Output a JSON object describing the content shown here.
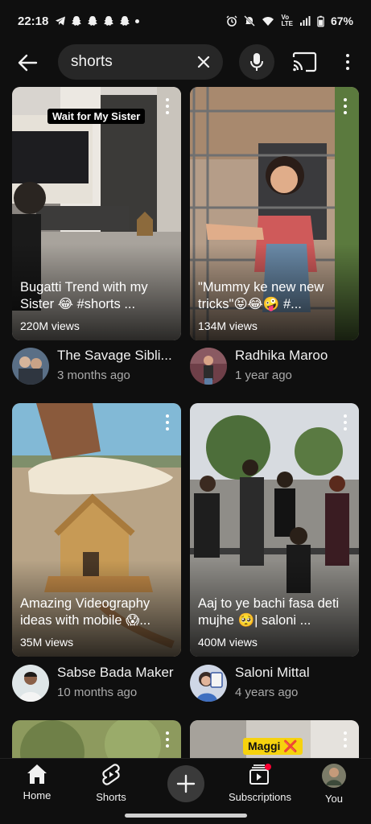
{
  "status_bar": {
    "time": "22:18",
    "battery": "67%"
  },
  "search": {
    "query": "shorts"
  },
  "results": [
    {
      "title": "Bugatti Trend with my Sister 😂 #shorts ...",
      "views": "220M views",
      "overlay_text": "Wait for My Sister",
      "channel": "The Savage Sibli...",
      "age": "3 months ago"
    },
    {
      "title": "\"Mummy ke new new tricks\"😝😂🤪 #...",
      "views": "134M views",
      "channel": "Radhika Maroo",
      "age": "1 year ago"
    },
    {
      "title": "Amazing Videography ideas with mobile 😱...",
      "views": "35M views",
      "channel": "Sabse Bada Maker",
      "age": "10 months ago"
    },
    {
      "title": "Aaj to ye bachi fasa deti mujhe 🥺| saloni ...",
      "views": "400M views",
      "channel": "Saloni Mittal",
      "age": "4 years ago"
    },
    {
      "overlay_text": "Maggi ❌"
    }
  ],
  "nav": {
    "items": [
      {
        "label": "Home",
        "icon": "home-icon"
      },
      {
        "label": "Shorts",
        "icon": "shorts-icon"
      },
      {
        "label": "",
        "icon": "create-icon"
      },
      {
        "label": "Subscriptions",
        "icon": "subscriptions-icon"
      },
      {
        "label": "You",
        "icon": "avatar"
      }
    ]
  },
  "colors": {
    "background": "#0f0f0f",
    "search_bg": "#272727",
    "secondary_text": "#aaaaaa",
    "notification_red": "#ff0033"
  }
}
